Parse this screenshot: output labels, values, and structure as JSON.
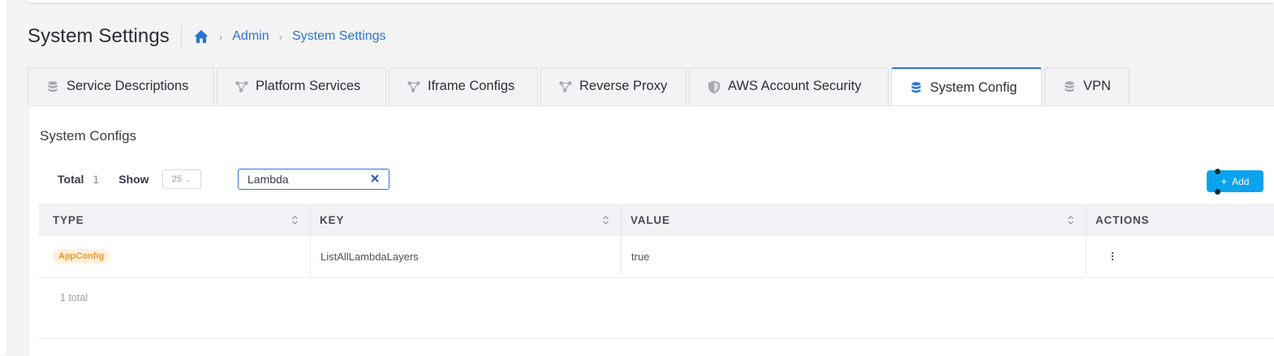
{
  "header": {
    "title": "System Settings",
    "breadcrumb": [
      "Admin",
      "System Settings"
    ]
  },
  "tabs": [
    {
      "label": "Service Descriptions",
      "icon": "database-icon",
      "active": false
    },
    {
      "label": "Platform Services",
      "icon": "share-nodes-icon",
      "active": false
    },
    {
      "label": "Iframe Configs",
      "icon": "share-nodes-icon",
      "active": false
    },
    {
      "label": "Reverse Proxy",
      "icon": "share-nodes-icon",
      "active": false
    },
    {
      "label": "AWS Account Security",
      "icon": "shield-icon",
      "active": false
    },
    {
      "label": "System Config",
      "icon": "database-icon",
      "active": true
    },
    {
      "label": "VPN",
      "icon": "database-icon",
      "active": false
    }
  ],
  "section": {
    "title": "System Configs",
    "total_label": "Total",
    "total_count": "1",
    "show_label": "Show",
    "page_size": "25",
    "search_value": "Lambda",
    "add_label": "Add"
  },
  "table": {
    "columns": [
      "TYPE",
      "KEY",
      "VALUE",
      "ACTIONS"
    ],
    "rows": [
      {
        "type": "AppConfig",
        "key": "ListAllLambdaLayers",
        "value": "true"
      }
    ],
    "footer": "1 total"
  },
  "colors": {
    "accent": "#2a74d8",
    "add_button": "#0aa4ee",
    "badge_bg": "#fff1df",
    "badge_text": "#f0962a"
  }
}
